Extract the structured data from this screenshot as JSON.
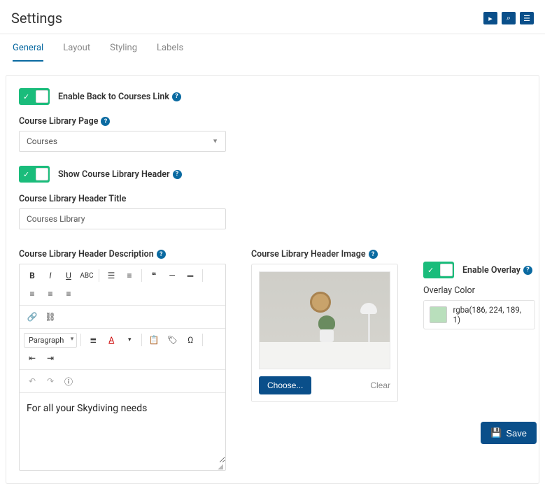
{
  "page_title": "Settings",
  "tabs": [
    "General",
    "Layout",
    "Styling",
    "Labels"
  ],
  "active_tab": "General",
  "toggle_back_label": "Enable Back to Courses Link",
  "library_page": {
    "label": "Course Library Page",
    "value": "Courses"
  },
  "toggle_header_label": "Show Course Library Header",
  "header_title": {
    "label": "Course Library Header Title",
    "value": "Courses Library"
  },
  "header_desc": {
    "label": "Course Library Header Description",
    "paragraph_label": "Paragraph",
    "content": "For all your Skydiving needs"
  },
  "header_image": {
    "label": "Course Library Header Image",
    "choose": "Choose...",
    "clear": "Clear"
  },
  "overlay": {
    "toggle_label": "Enable Overlay",
    "color_label": "Overlay Color",
    "value": "rgba(186, 224, 189, 1)"
  },
  "save_label": "Save"
}
